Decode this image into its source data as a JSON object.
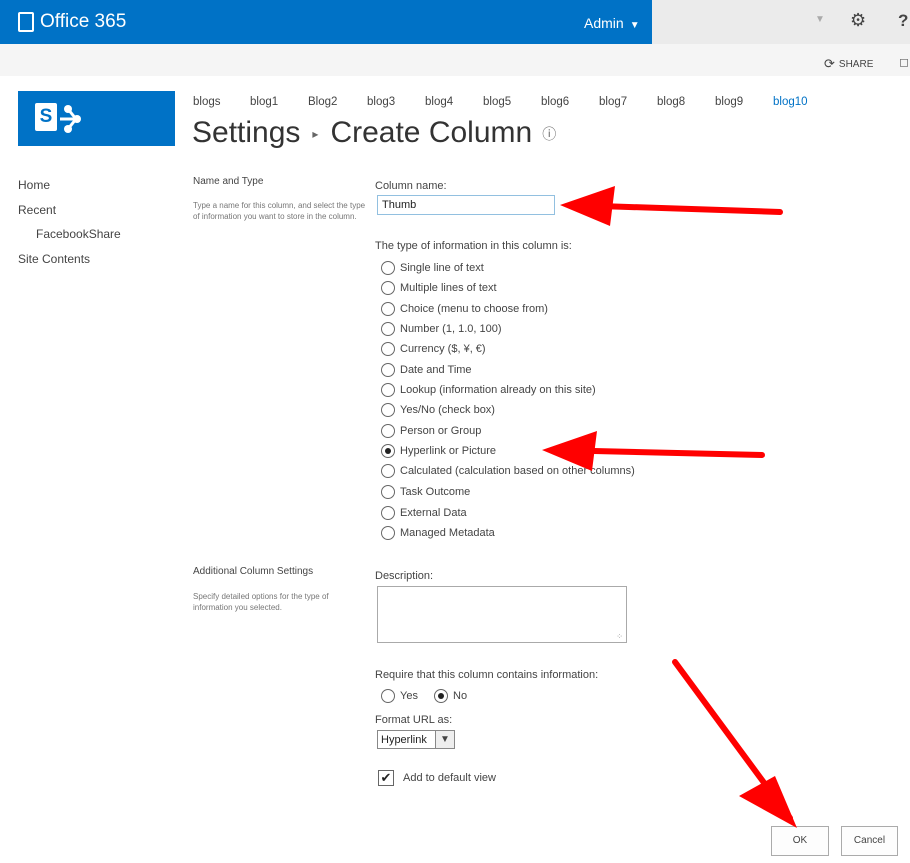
{
  "suite_bar": {
    "brand": "Office 365",
    "user": "Admin",
    "share_label": "SHARE",
    "colors": {
      "suite_blue": "#0072c6",
      "annotation_red": "#ff0000"
    }
  },
  "site_tabs": [
    "blogs",
    "blog1",
    "Blog2",
    "blog3",
    "blog4",
    "blog5",
    "blog6",
    "blog7",
    "blog8",
    "blog9",
    "blog10"
  ],
  "active_tab": "blog10",
  "page_title": {
    "parent": "Settings",
    "current": "Create Column"
  },
  "left_nav": [
    "Home",
    "Recent",
    "FacebookShare",
    "Site Contents"
  ],
  "section_name_type": {
    "title": "Name and Type",
    "description": "Type a name for this column, and select the type of information you want to store in the column."
  },
  "column_name": {
    "label": "Column name:",
    "value": "Thumb"
  },
  "type_question": "The type of information in this column is:",
  "column_types": [
    "Single line of text",
    "Multiple lines of text",
    "Choice (menu to choose from)",
    "Number (1, 1.0, 100)",
    "Currency ($, ¥, €)",
    "Date and Time",
    "Lookup (information already on this site)",
    "Yes/No (check box)",
    "Person or Group",
    "Hyperlink or Picture",
    "Calculated (calculation based on other columns)",
    "Task Outcome",
    "External Data",
    "Managed Metadata"
  ],
  "selected_type": "Hyperlink or Picture",
  "section_additional": {
    "title": "Additional Column Settings",
    "description": "Specify detailed options for the type of information you selected."
  },
  "description_label": "Description:",
  "require": {
    "label": "Require that this column contains information:",
    "yes": "Yes",
    "no": "No",
    "selected": "No"
  },
  "format_url": {
    "label": "Format URL as:",
    "value": "Hyperlink"
  },
  "add_default_view": {
    "label": "Add to default view",
    "checked": true
  },
  "buttons": {
    "ok": "OK",
    "cancel": "Cancel"
  }
}
